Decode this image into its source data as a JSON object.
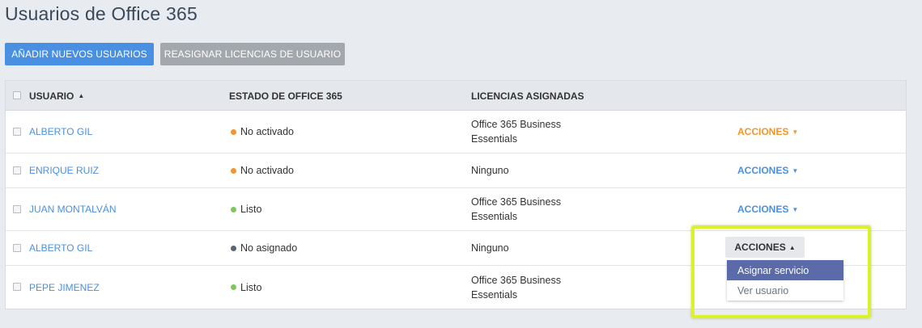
{
  "page": {
    "title": "Usuarios de Office 365"
  },
  "toolbar": {
    "add_label": "AÑADIR NUEVOS USUARIOS",
    "reassign_label": "REASIGNAR LICENCIAS DE USUARIO"
  },
  "table": {
    "headers": {
      "user": "USUARIO",
      "status": "ESTADO DE OFFICE 365",
      "licenses": "LICENCIAS ASIGNADAS"
    },
    "rows": [
      {
        "user": "ALBERTO GIL",
        "status": "No activado",
        "status_color": "#f5942b",
        "lic1": "Office 365 Business",
        "lic2": "Essentials",
        "actions": "ACCIONES",
        "actions_color": "#f5942b"
      },
      {
        "user": "ENRIQUE RUIZ",
        "status": "No activado",
        "status_color": "#f5942b",
        "lic1": "Ninguno",
        "lic2": "",
        "actions": "ACCIONES",
        "actions_color": "#4a90e2"
      },
      {
        "user": "JUAN MONTALVÁN",
        "status": "Listo",
        "status_color": "#7cc95b",
        "lic1": "Office 365 Business",
        "lic2": "Essentials",
        "actions": "ACCIONES",
        "actions_color": "#4a90e2"
      },
      {
        "user": "ALBERTO GIL",
        "status": "No asignado",
        "status_color": "#5a6476",
        "lic1": "Ninguno",
        "lic2": "",
        "actions": "ACCIONES"
      },
      {
        "user": "PEPE JIMENEZ",
        "status": "Listo",
        "status_color": "#7cc95b",
        "lic1": "Office 365 Business",
        "lic2": "Essentials"
      }
    ]
  },
  "dropdown": {
    "items": [
      "Asignar servicio",
      "Ver usuario"
    ]
  },
  "colors": {
    "accent": "#4a90e2",
    "highlight": "#d9f22b",
    "dropdown_active": "#5b6aa8"
  }
}
